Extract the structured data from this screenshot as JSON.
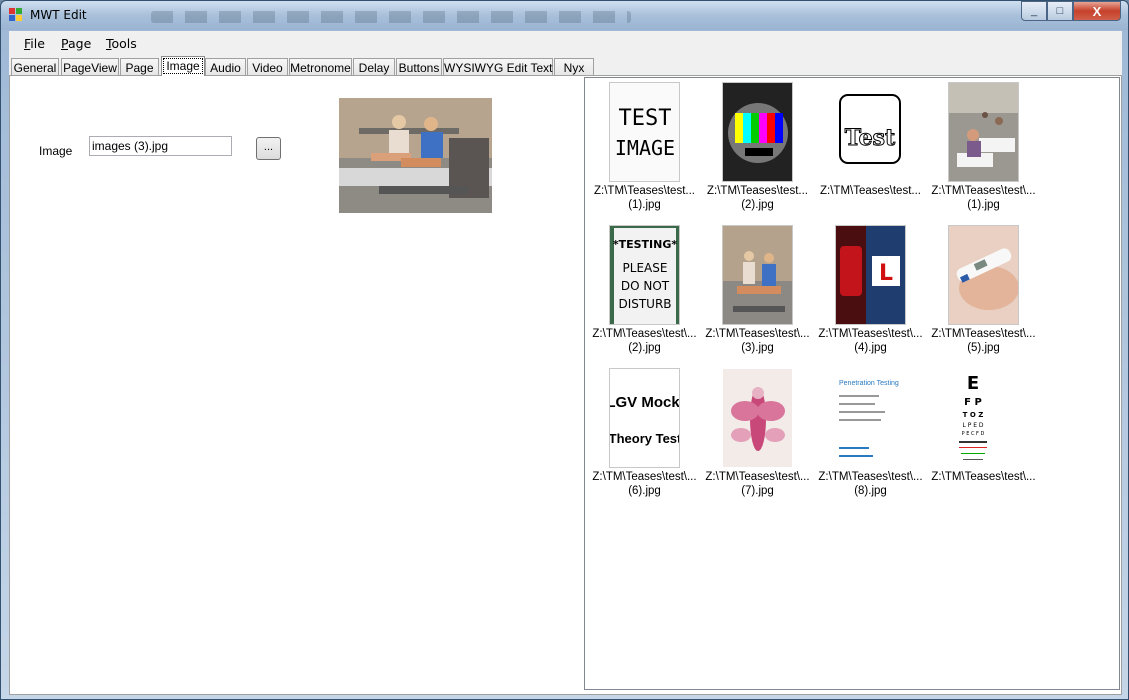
{
  "window": {
    "title": "MWT Edit",
    "controls": {
      "minimize": "_",
      "maximize": "□",
      "close": "X"
    }
  },
  "menu": {
    "items": [
      {
        "label": "File",
        "mnemonic": "F",
        "rest": "ile"
      },
      {
        "label": "Page",
        "mnemonic": "P",
        "rest": "age"
      },
      {
        "label": "Tools",
        "mnemonic": "T",
        "rest": "ools"
      }
    ]
  },
  "tabs": [
    "General",
    "PageView",
    "Page",
    "Image",
    "Audio",
    "Video",
    "Metronome",
    "Delay",
    "Buttons",
    "WYSIWYG Edit Text",
    "Nyx"
  ],
  "active_tab": "Image",
  "image_form": {
    "label": "Image",
    "value": "images (3).jpg",
    "browse_label": "..."
  },
  "thumbnails": [
    {
      "path": "Z:\\TM\\Teases\\test...",
      "file": "(1).jpg",
      "icon": "test-image-text"
    },
    {
      "path": "Z:\\TM\\Teases\\test...",
      "file": "(2).jpg",
      "icon": "test-card"
    },
    {
      "path": "Z:\\TM\\Teases\\test...",
      "file": "",
      "icon": "test-sketch"
    },
    {
      "path": "Z:\\TM\\Teases\\test\\...",
      "file": "(1).jpg",
      "icon": "exam-room-photo"
    },
    {
      "path": "Z:\\TM\\Teases\\test\\...",
      "file": "(2).jpg",
      "icon": "testing-sign"
    },
    {
      "path": "Z:\\TM\\Teases\\test\\...",
      "file": "(3).jpg",
      "icon": "crash-dummies-photo"
    },
    {
      "path": "Z:\\TM\\Teases\\test\\...",
      "file": "(4).jpg",
      "icon": "l-plate-car-photo"
    },
    {
      "path": "Z:\\TM\\Teases\\test\\...",
      "file": "(5).jpg",
      "icon": "pregnancy-test-photo"
    },
    {
      "path": "Z:\\TM\\Teases\\test\\...",
      "file": "(6).jpg",
      "icon": "lgv-mock-theory-test"
    },
    {
      "path": "Z:\\TM\\Teases\\test\\...",
      "file": "(7).jpg",
      "icon": "inkblot"
    },
    {
      "path": "Z:\\TM\\Teases\\test\\...",
      "file": "(8).jpg",
      "icon": "penetration-testing-slide"
    },
    {
      "path": "Z:\\TM\\Teases\\test\\...",
      "file": "",
      "icon": "eye-chart"
    }
  ],
  "thumb_text": {
    "test_image": [
      "TEST",
      "IMAGE"
    ],
    "test_sketch": "Test",
    "testing_sign": [
      "*TESTING*",
      "PLEASE",
      "DO NOT",
      "DISTURB"
    ],
    "l_plate": "L",
    "lgv": [
      "LGV Mock",
      "Theory Test"
    ],
    "pentest_title": "Penetration Testing",
    "eye_chart": [
      "E",
      "F P",
      "T O Z",
      "L P E D",
      "P E C F D"
    ]
  }
}
